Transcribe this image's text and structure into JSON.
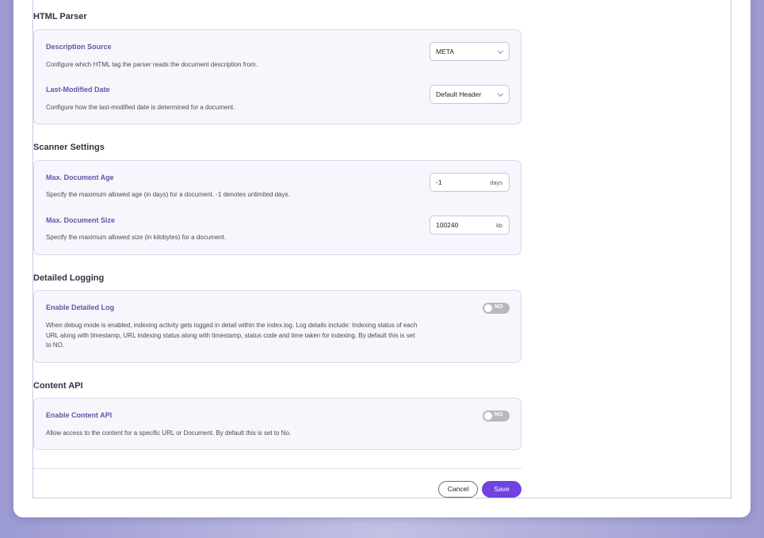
{
  "sections": {
    "html_parser": {
      "title": "HTML Parser",
      "description_source": {
        "label": "Description Source",
        "desc": "Configure which HTML tag the parser reads the document description from.",
        "value": "META"
      },
      "last_modified": {
        "label": "Last-Modified Date",
        "desc": "Configure how the last-modified date is determined for a document.",
        "value": "Default Header"
      }
    },
    "scanner": {
      "title": "Scanner Settings",
      "max_age": {
        "label": "Max. Document Age",
        "desc": "Specify the maximum allowed age (in days) for a document. -1 denotes unlimited days.",
        "value": "-1",
        "unit": "days"
      },
      "max_size": {
        "label": "Max. Document Size",
        "desc": "Specify the maximum allowed size (in kilobytes) for a document.",
        "value": "100240",
        "unit": "kb"
      }
    },
    "logging": {
      "title": "Detailed Logging",
      "enable": {
        "label": "Enable Detailed Log",
        "desc_line1": "When debug mode is enabled, indexing activity gets logged in detail within the index.log. Log details include: Indexing status of each",
        "desc_line2": "URL along with timestamp, URL indexing status along with timestamp, status code and time taken for indexing. By default this is set",
        "desc_line3": "to NO.",
        "toggle": "NO"
      }
    },
    "content_api": {
      "title": "Content API",
      "enable": {
        "label": "Enable Content API",
        "desc": "Allow access to the content for a specific URL or Document. By default this is set to No.",
        "toggle": "NO"
      }
    }
  },
  "footer": {
    "cancel_label": "Cancel",
    "save_label": "Save"
  },
  "colors": {
    "accent": "#7043e0",
    "label": "#5f57a8",
    "toggle_off": "#b8b8c0"
  }
}
